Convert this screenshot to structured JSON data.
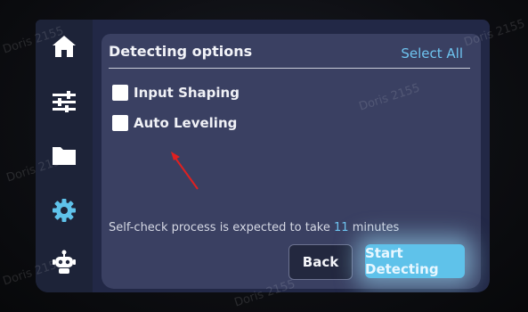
{
  "sidebar": {
    "items": [
      {
        "name": "home",
        "icon": "home-icon"
      },
      {
        "name": "tune",
        "icon": "sliders-icon"
      },
      {
        "name": "files",
        "icon": "folder-icon"
      },
      {
        "name": "settings",
        "icon": "gear-icon",
        "active": true
      },
      {
        "name": "robot",
        "icon": "robot-icon"
      }
    ]
  },
  "panel": {
    "title": "Detecting options",
    "select_all": "Select All",
    "options": [
      {
        "label": "Input Shaping",
        "checked": false
      },
      {
        "label": "Auto Leveling",
        "checked": false
      }
    ],
    "estimate_text": "Self-check process is expected to take",
    "estimate_value": "11",
    "estimate_unit": "minutes"
  },
  "buttons": {
    "back": "Back",
    "start": "Start Detecting"
  },
  "watermark": "Doris 2155",
  "colors": {
    "screen_bg": "#222846",
    "panel_bg": "#3a4062",
    "accent": "#6ec4f0",
    "annotation_arrow": "#e02020"
  }
}
